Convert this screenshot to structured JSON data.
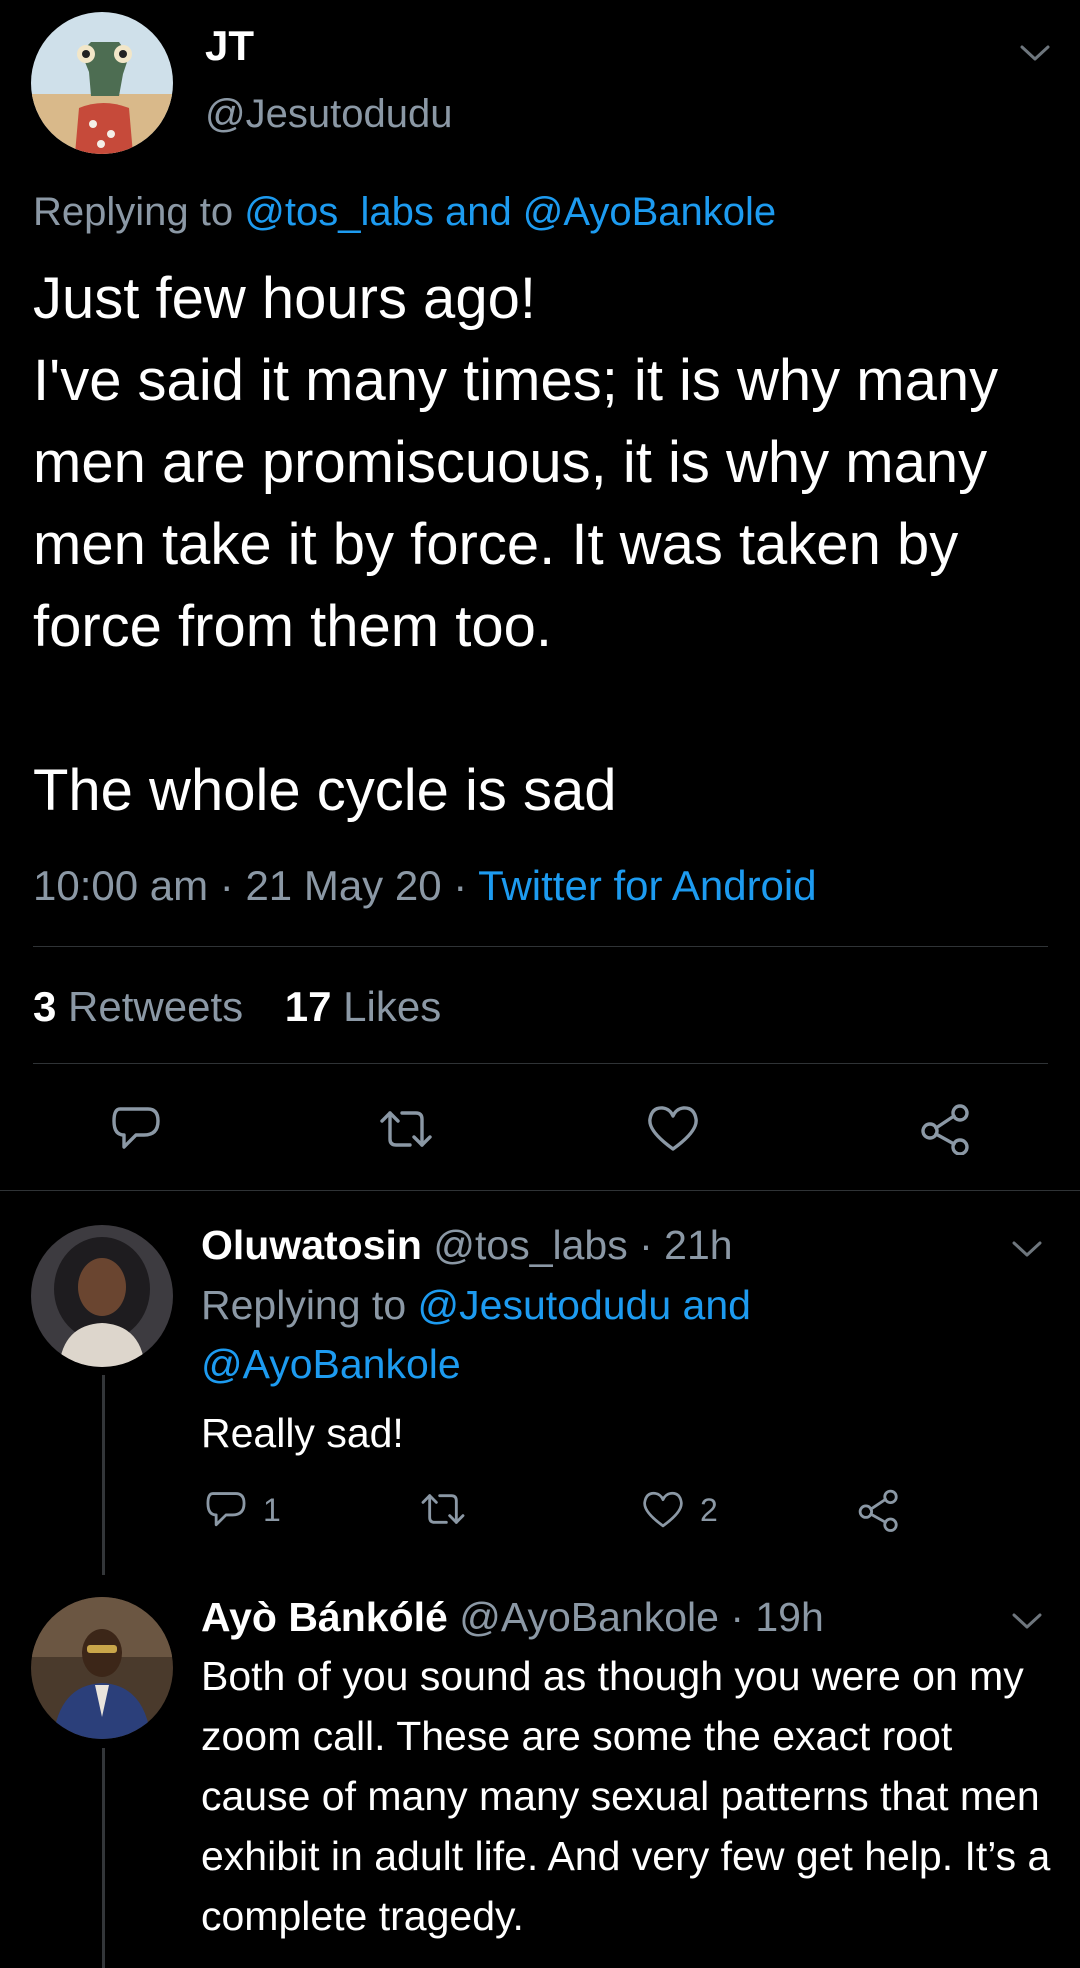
{
  "main_tweet": {
    "name": "JT",
    "handle": "@Jesutodudu",
    "replying_prefix": "Replying to",
    "replying_to": "@tos_labs and @AyoBankole",
    "text": "Just few hours ago!\nI've said it many times; it is why many men are promiscuous, it is why many men take it by force. It was taken by force from them too.\n\nThe whole cycle is sad",
    "time": "10:00 am · 21 May 20 · ",
    "source": "Twitter for Android",
    "retweets_count": "3",
    "retweets_label": "Retweets",
    "likes_count": "17",
    "likes_label": "Likes",
    "avatar_icon": "chameleon-avatar"
  },
  "replies": [
    {
      "name": "Oluwatosin",
      "meta": "@tos_labs · 21h",
      "replying_prefix": "Replying to",
      "replying_to_line1": "@Jesutodudu and",
      "replying_to_line2": "@AyoBankole",
      "text": "Really sad!",
      "reply_count": "1",
      "retweet_count": "",
      "like_count": "2"
    },
    {
      "name": "Ayò Bánkólé",
      "meta": "@AyoBankole · 19h",
      "text": "Both of you sound as though you were on my zoom call. These are some the exact root cause of many many sexual patterns that men exhibit in adult life. And very few get help. It’s a complete tragedy."
    }
  ],
  "icons": [
    "chevron-down-icon",
    "reply-icon",
    "retweet-icon",
    "like-icon",
    "share-icon"
  ],
  "colors": {
    "background": "#000000",
    "accent": "#1d9bf0",
    "secondary_text": "#8b98a5"
  }
}
